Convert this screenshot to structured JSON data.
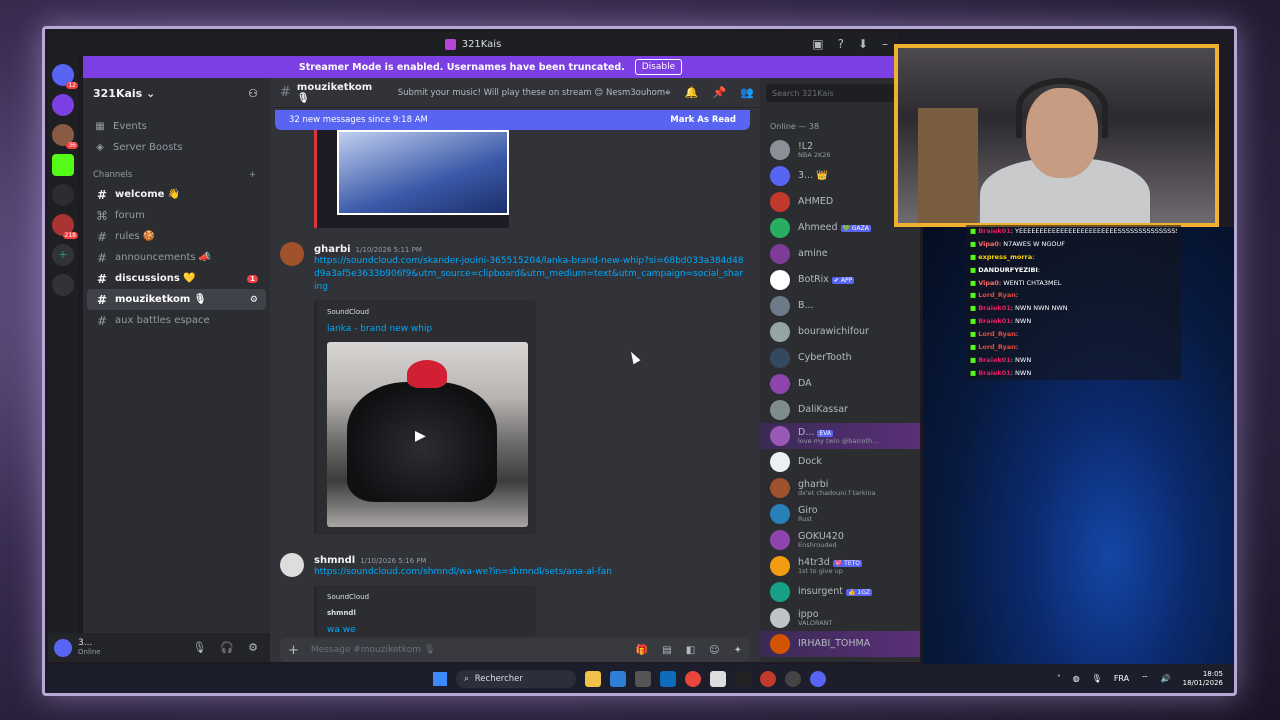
{
  "window": {
    "title": "321Kais"
  },
  "banner": {
    "text": "Streamer Mode is enabled. Usernames have been truncated.",
    "button": "Disable"
  },
  "guild_badges": [
    "12",
    "36",
    "218"
  ],
  "server": {
    "name": "321Kais ⌄"
  },
  "sidebar": {
    "events": "Events",
    "boosts": "Server Boosts",
    "category": "Channels",
    "channels": [
      {
        "name": "welcome 👋",
        "state": "unread"
      },
      {
        "name": "forum",
        "state": "normal"
      },
      {
        "name": "rules 🍪",
        "state": "normal"
      },
      {
        "name": "announcements 📣",
        "state": "normal"
      },
      {
        "name": "discussions 💛",
        "state": "unread",
        "badge": "1"
      },
      {
        "name": "mouziketkom 🎙",
        "state": "active"
      },
      {
        "name": "aux battles espace",
        "state": "normal"
      }
    ]
  },
  "user": {
    "name": "3...",
    "status": "Online"
  },
  "channel": {
    "name": "mouziketkom 🎙",
    "topic": "Submit your music! Will play these on stream 😊 Nesm3ouhom maa baa..."
  },
  "new_messages": {
    "text": "32 new messages since 9:18 AM",
    "action": "Mark As Read"
  },
  "messages": [
    {
      "author": "gharbi",
      "time": "1/10/2026 5:11 PM",
      "link": "https://soundcloud.com/skander-jouini-365515204/lanka-brand-new-whip?si=68bd033a384d48d9a3af5e3633b906f9&utm_source=clipboard&utm_medium=text&utm_campaign=social_sharing",
      "embed": {
        "provider": "SoundCloud",
        "title": "lanka - brand new whip"
      }
    },
    {
      "author": "shmndl",
      "time": "1/10/2026 5:16 PM",
      "link": "https://soundcloud.com/shmndl/wa-we?in=shmndl/sets/ana-al-fan",
      "embed": {
        "provider": "SoundCloud",
        "author": "shmndl",
        "title": "wa we"
      }
    }
  ],
  "composer": {
    "placeholder": "Message #mouziketkom 🎙"
  },
  "members": {
    "search_placeholder": "Search 321Kais",
    "online_header": "Online — 38",
    "list": [
      {
        "name": "!L2",
        "status": "NBA 2K26",
        "color": "#8a8f98"
      },
      {
        "name": "3... 👑",
        "status": "",
        "color": "#5865f2"
      },
      {
        "name": "AHMED",
        "status": "",
        "color": "#c0392b"
      },
      {
        "name": "Ahmeed",
        "tag": "💚 GAZA",
        "status": "",
        "color": "#27ae60"
      },
      {
        "name": "amine",
        "status": "",
        "color": "#7d3c98"
      },
      {
        "name": "BotRix",
        "tag": "✔ APP",
        "status": "",
        "color": "#fff"
      },
      {
        "name": "B...",
        "status": "",
        "color": "#6c7a89"
      },
      {
        "name": "bourawichifour",
        "status": "",
        "color": "#95a5a6"
      },
      {
        "name": "CyberTooth",
        "status": "",
        "color": "#34495e"
      },
      {
        "name": "DA",
        "status": "",
        "color": "#8e44ad"
      },
      {
        "name": "DaliKassar",
        "status": "",
        "color": "#7f8c8d"
      },
      {
        "name": "D...",
        "tag": "EVA",
        "status": "love my twin @barroth...",
        "color": "#9b59b6",
        "highlight": true
      },
      {
        "name": "Dock",
        "status": "",
        "color": "#ecf0f1"
      },
      {
        "name": "gharbi",
        "status": "dx'et chadouni f tarkina",
        "color": "#a0522d"
      },
      {
        "name": "Giro",
        "status": "Rust",
        "color": "#2980b9"
      },
      {
        "name": "GOKU420",
        "status": "Enshrouded",
        "color": "#8e44ad"
      },
      {
        "name": "h4tr3d",
        "tag": "💖 TETO",
        "status": "1st to give up",
        "color": "#f39c12"
      },
      {
        "name": "insurgent",
        "tag": "👍 1GZ",
        "status": "",
        "color": "#16a085"
      },
      {
        "name": "ippo",
        "status": "VALORANT",
        "color": "#bdc3c7"
      },
      {
        "name": "IRHABI_TOHMA",
        "status": "",
        "color": "#d35400",
        "highlight": true
      }
    ]
  },
  "twitch_chat": [
    {
      "user": "Braiek01",
      "msg": ": YEEEEEEEEEEEEEEEEEEEEEEEESSSSSSSSSSSSSSSSS",
      "color": "#e91e63"
    },
    {
      "user": "Vipa0",
      "msg": ": N7AWES W NGOUF",
      "color": "#ff6b6b"
    },
    {
      "user": "express_morra",
      "msg": ":",
      "color": "#ffd700"
    },
    {
      "user": "DANDURFYEZIBI",
      "msg": ":",
      "color": "#ffffff"
    },
    {
      "user": "Vipa0",
      "msg": ": WENTI CHTA3MEL",
      "color": "#ff6b6b"
    },
    {
      "user": "Lord_Ryan",
      "msg": ":",
      "color": "#e74c3c"
    },
    {
      "user": "Braiek01",
      "msg": ": NWN NWN NWN",
      "color": "#e91e63"
    },
    {
      "user": "Braiek01",
      "msg": ": NWN",
      "color": "#e91e63"
    },
    {
      "user": "Lord_Ryan",
      "msg": ":",
      "color": "#e74c3c"
    },
    {
      "user": "Lord_Ryan",
      "msg": ":",
      "color": "#e74c3c"
    },
    {
      "user": "Braiek01",
      "msg": ": NWN",
      "color": "#e91e63"
    },
    {
      "user": "Braiek01",
      "msg": ": NWN",
      "color": "#e91e63"
    }
  ],
  "taskbar": {
    "search": "Rechercher",
    "lang": "FRA",
    "time": "18:05",
    "date": "18/01/2026"
  },
  "colors": {
    "accent": "#5865f2",
    "streamer_banner": "#7b3fe4",
    "webcam_border": "#f0b030"
  }
}
